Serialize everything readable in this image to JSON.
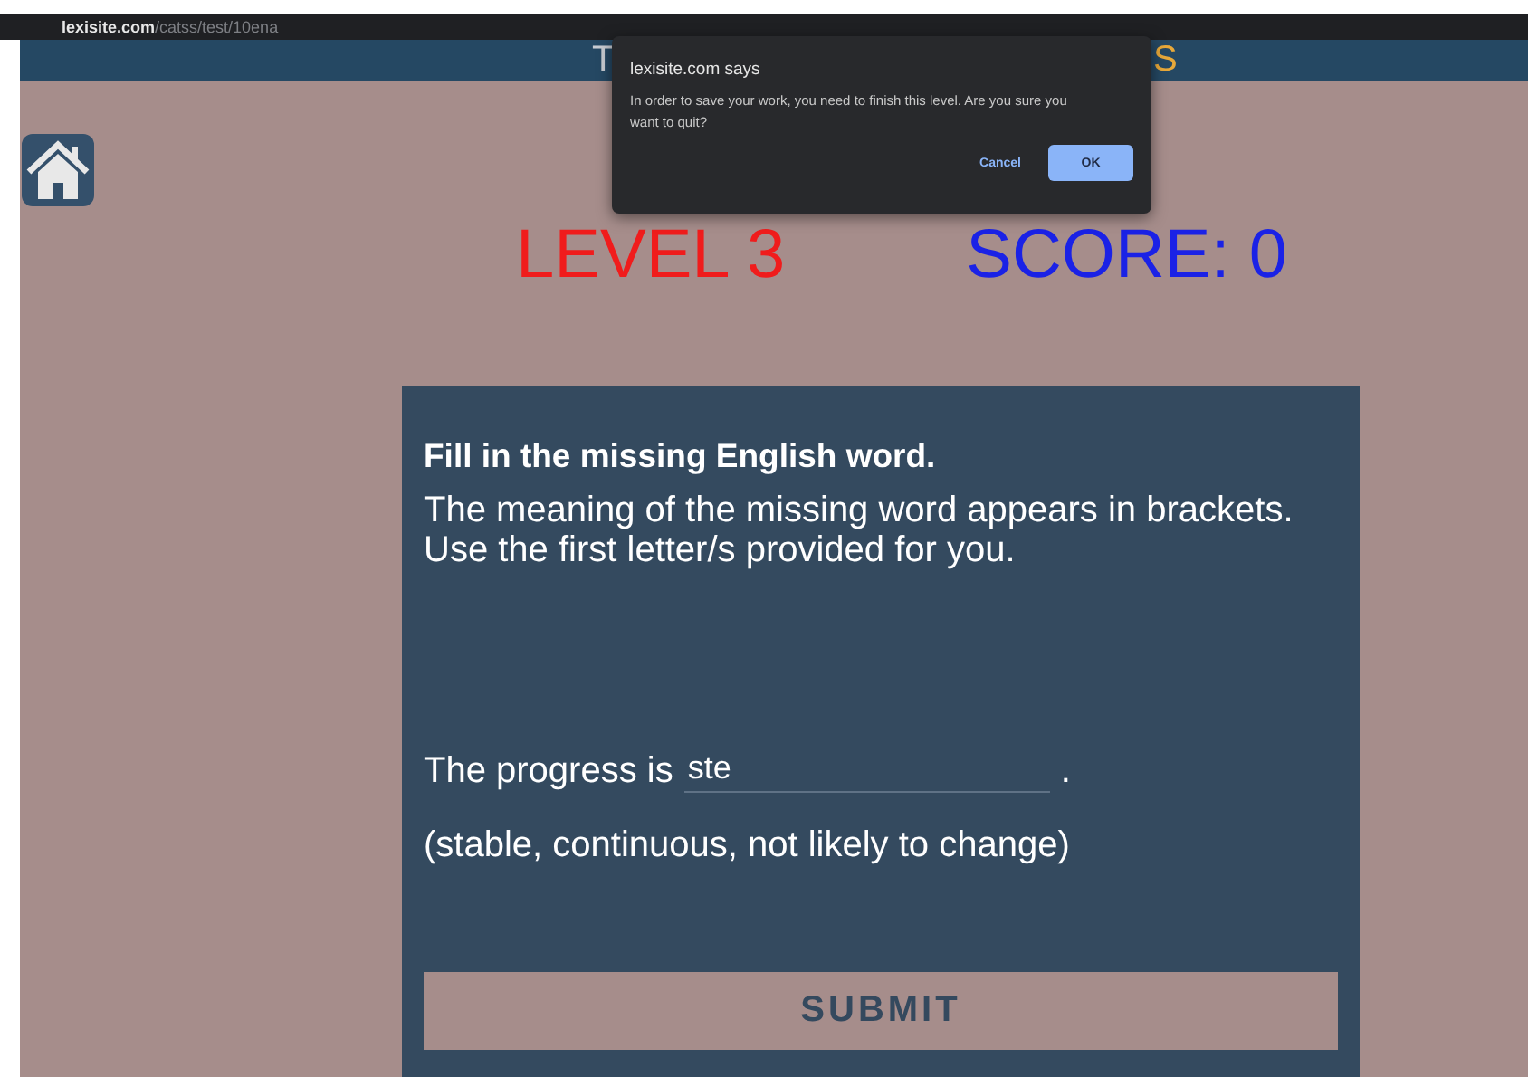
{
  "browser": {
    "domain": "lexisite.com",
    "path": "/catss/test/10ena"
  },
  "header": {
    "title_start": "T",
    "title_end": "S"
  },
  "game": {
    "level": "LEVEL 3",
    "score": "SCORE: 0"
  },
  "exercise": {
    "heading": "Fill in the missing English word.",
    "instructions": "The meaning of the missing word appears in brackets. Use the first letter/s provided for you.",
    "sentence_start": "The progress is",
    "answer": "ste",
    "sentence_end": ".",
    "hint": "(stable, continuous, not likely to change)",
    "submit": "SUBMIT"
  },
  "dialog": {
    "title": "lexisite.com says",
    "message": "In order to save your work, you need to finish this level. Are you sure you want to quit?",
    "buttons": [
      {
        "label": "Cancel",
        "kind": "secondary"
      },
      {
        "label": "OK",
        "kind": "primary"
      }
    ]
  }
}
